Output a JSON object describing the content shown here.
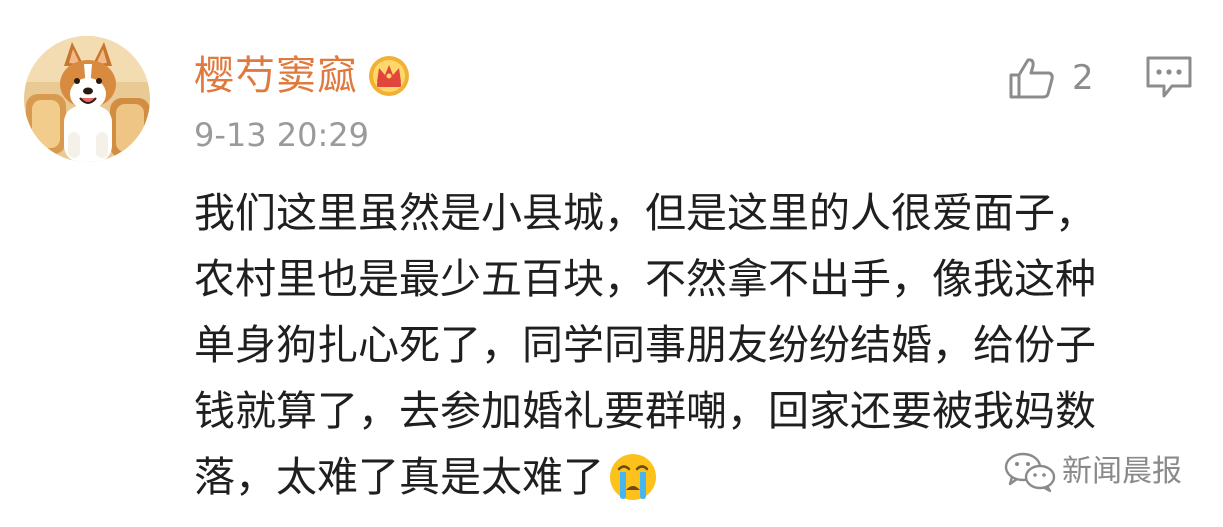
{
  "comment": {
    "author": {
      "name": "樱芍窦窳"
    },
    "timestamp": "9-13 20:29",
    "likes": {
      "count": "2"
    },
    "content_lines": [
      "我们这里虽然是小县城，但是这里的人很爱面子，",
      "农村里也是最少五百块，不然拿不出手，像我这种",
      "单身狗扎心死了，同学同事朋友纷纷结婚，给份子",
      "钱就算了，去参加婚礼要群嘲，回家还要被我妈数",
      "落，太难了真是太难了"
    ]
  },
  "watermark": {
    "text": "新闻晨报"
  },
  "icons": {
    "avatar": "corgi-avatar",
    "badge": "vip-crown-icon",
    "like": "thumbs-up-icon",
    "reply": "comment-icon",
    "emoji": "crying-face-emoji",
    "watermark": "wechat-icon"
  },
  "colors": {
    "username": "#e0793e",
    "timestamp": "#9a9a9a",
    "text": "#1f1f1f",
    "icon_gray": "#8c8c8c",
    "emoji_yellow": "#fcc21b",
    "tears_blue": "#47b6ee",
    "crown_gold": "#f2b035",
    "badge_red": "#e2453c"
  }
}
